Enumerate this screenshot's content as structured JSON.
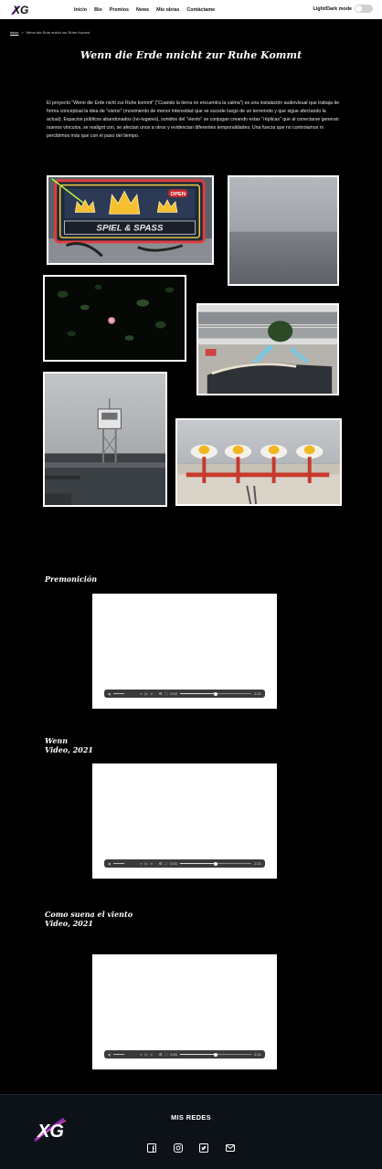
{
  "header": {
    "logo_text": "XG",
    "nav": [
      "Inicio",
      "Bio",
      "Premios",
      "News",
      "Mis obras",
      "Contáctame"
    ],
    "mode_label": "Light/Dark mode"
  },
  "breadcrumb": {
    "home": "Inicio",
    "separator": ">",
    "current": "Wenn die Erde nnicht zur Ruhe Kommt"
  },
  "page": {
    "title": "Wenn die Erde nnicht zur Ruhe Kommt",
    "description": "El proyecto \"Wenn die Erde nicht zur Ruhe kommt\" (\"Cuando la tierra no encuentra la calma\") es una instalación audiovisual que trabaja de forma conceptual la idea de \"sismo\" (movimiento de menor intensidad que se sucede luego de un terremoto y que sigue afectando la actual). Espacios públicos abandonados (no-lugares), sonidos del \"viento\" se conjugan creando estas \"réplicas\" que al conectarse generan nuevos vínculos, se realignt con, se afectan unos a otros y evidencian diferentes temporalidades. Una fuerza que no controlamos ni percibimos más que con el paso del tiempo."
  },
  "gallery": {
    "photo1_sign_top": "OPEN",
    "photo1_sign_text": "SPIEL & SPASS"
  },
  "videos": [
    {
      "title_line1": "Premonición",
      "title_line2": "",
      "time": "0:01",
      "duration": "2:21",
      "progress": 0.5
    },
    {
      "title_line1": "Wenn",
      "title_line2": "Video, 2021",
      "time": "0:01",
      "duration": "2:21",
      "progress": 0.5
    },
    {
      "title_line1": "Como suena el viento",
      "title_line2": "Video, 2021",
      "time": "0:01",
      "duration": "2:21",
      "progress": 0.5
    }
  ],
  "footer": {
    "social_title": "MIS REDES",
    "social_icons": [
      "facebook-icon",
      "instagram-icon",
      "twitter-icon",
      "mail-icon"
    ]
  },
  "colors": {
    "background": "#000000",
    "header_bg": "#ffffff",
    "footer_bg": "#0d1118",
    "logo_purple": "#8e2bb8"
  }
}
